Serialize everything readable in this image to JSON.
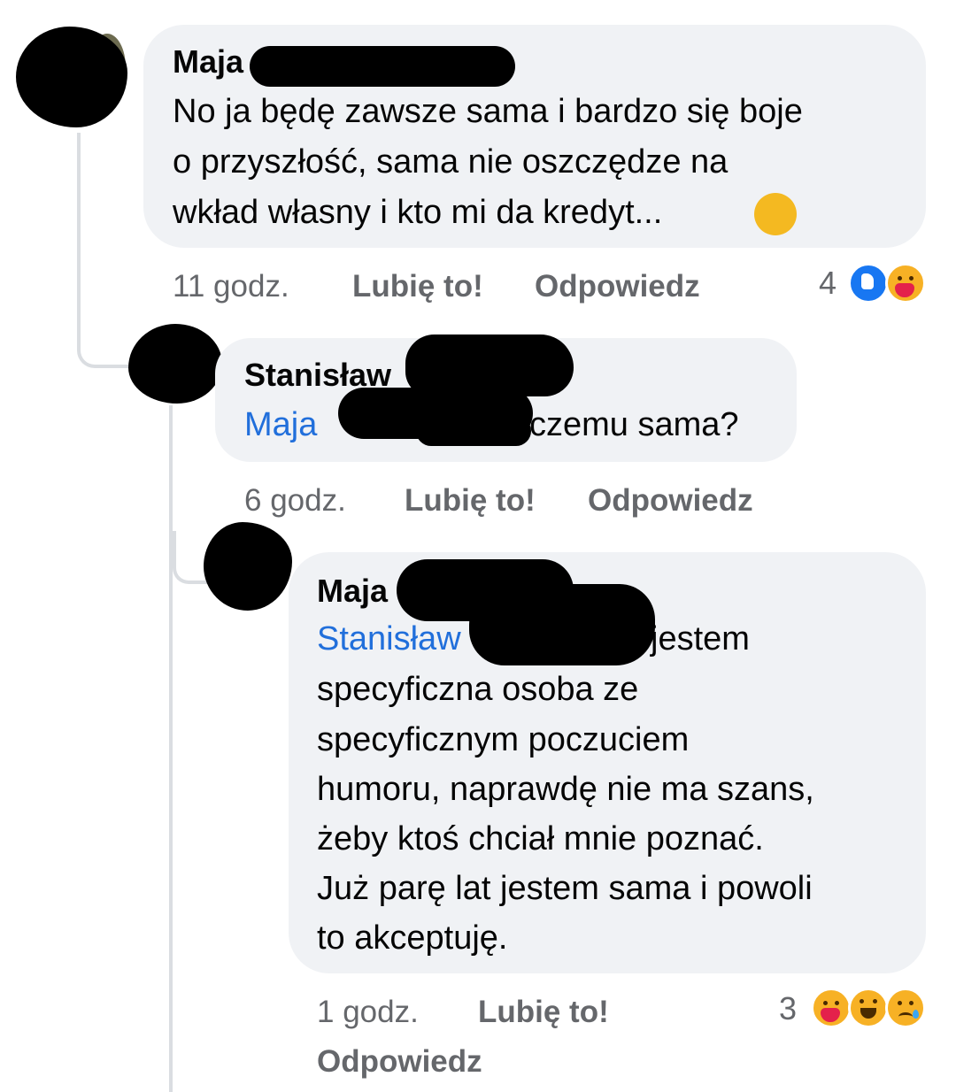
{
  "comments": [
    {
      "author": "Maja",
      "text_lines": [
        "No ja będę zawsze sama i bardzo się boje",
        "o przyszłość, sama nie oszczędze na",
        "wkład własny i kto mi da kredyt..."
      ],
      "emoji": "sad-face",
      "time": "11 godz.",
      "like_label": "Lubię to!",
      "reply_label": "Odpowiedz",
      "reaction_count": "4",
      "reactions": [
        "like",
        "care"
      ]
    },
    {
      "author": "Stanisław",
      "mention": "Maja",
      "text_tail": "czemu sama?",
      "time": "6 godz.",
      "like_label": "Lubię to!",
      "reply_label": "Odpowiedz"
    },
    {
      "author": "Maja",
      "mention": "Stanisław",
      "text_first_tail": "jestem",
      "text_lines": [
        "specyficzna osoba ze",
        "specyficznym poczuciem",
        "humoru, naprawdę nie ma szans,",
        "żeby ktoś chciał mnie poznać.",
        "Już parę lat jestem sama i powoli",
        "to akceptuję."
      ],
      "time": "1 godz.",
      "like_label": "Lubię to!",
      "reply_label": "Odpowiedz",
      "reaction_count": "3",
      "reactions": [
        "care",
        "haha",
        "sad"
      ]
    }
  ],
  "colors": {
    "bubble": "#f0f2f5",
    "meta": "#65676b",
    "mention": "#216fdb",
    "line": "#dadde1"
  }
}
